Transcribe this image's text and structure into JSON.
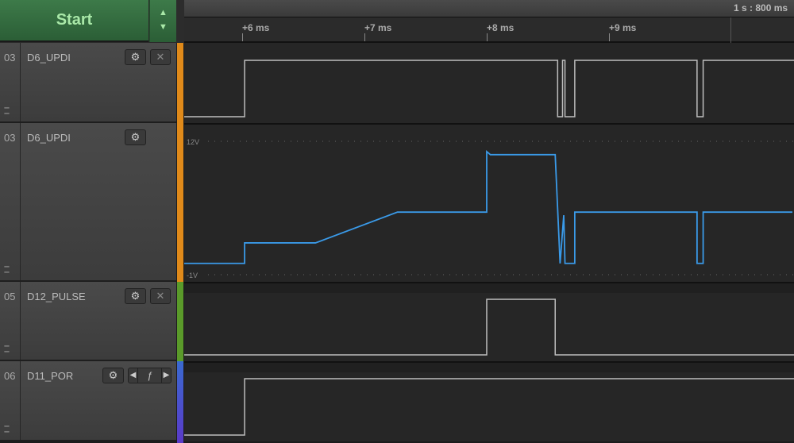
{
  "header": {
    "start_label": "Start",
    "scale_label": "1 s : 800 ms",
    "ticks": [
      "+6 ms",
      "+7 ms",
      "+8 ms",
      "+9 ms"
    ],
    "tick_ms": [
      6,
      7,
      8,
      9
    ]
  },
  "channels": [
    {
      "num": "03",
      "name": "D6_UPDI",
      "type": "digital",
      "color": "#e08a1a",
      "buttons": [
        "gear",
        "close"
      ],
      "init": 0,
      "edges_ms": [
        6.02,
        8.58,
        8.62,
        8.64,
        8.72,
        9.72,
        9.77
      ]
    },
    {
      "num": "03",
      "name": "D6_UPDI",
      "type": "analog",
      "color": "#e08a1a",
      "buttons": [
        "gear"
      ],
      "vmax_label": "12V",
      "vmin_label": "-1V",
      "vrange": [
        -1,
        12
      ],
      "points": [
        [
          5.5,
          0.1
        ],
        [
          6.02,
          0.1
        ],
        [
          6.02,
          2.1
        ],
        [
          6.6,
          2.1
        ],
        [
          7.27,
          5.1
        ],
        [
          8.0,
          5.1
        ],
        [
          8.0,
          11.0
        ],
        [
          8.03,
          10.7
        ],
        [
          8.56,
          10.7
        ],
        [
          8.6,
          0.1
        ],
        [
          8.63,
          4.8
        ],
        [
          8.64,
          0.1
        ],
        [
          8.72,
          0.1
        ],
        [
          8.72,
          5.1
        ],
        [
          9.72,
          5.1
        ],
        [
          9.72,
          0.1
        ],
        [
          9.77,
          0.1
        ],
        [
          9.77,
          5.1
        ],
        [
          10.5,
          5.1
        ]
      ]
    },
    {
      "num": "05",
      "name": "D12_PULSE",
      "type": "digital",
      "color": "#5a9a2a",
      "buttons": [
        "gear",
        "close"
      ],
      "init": 0,
      "edges_ms": [
        8.0,
        8.56
      ]
    },
    {
      "num": "06",
      "name": "D11_POR",
      "type": "digital",
      "color": "#4a4ad0",
      "buttons": [
        "gear",
        "nav"
      ],
      "init": 0,
      "edges_ms": [
        6.02
      ]
    }
  ]
}
